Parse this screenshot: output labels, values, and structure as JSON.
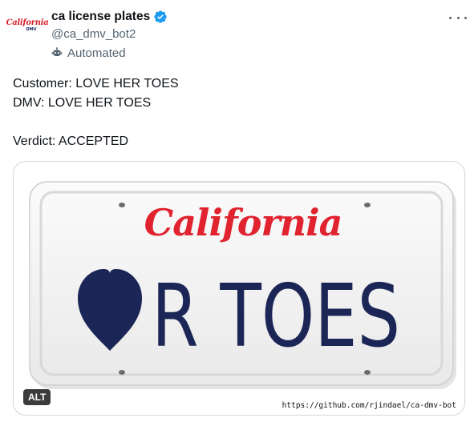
{
  "account": {
    "display_name": "ca license plates",
    "handle": "@ca_dmv_bot2",
    "automated_label": "Automated",
    "verified": true,
    "avatar_logo_text": "California",
    "avatar_logo_sub": "DMV"
  },
  "post": {
    "lines": [
      "Customer: LOVE HER TOES",
      "DMV: LOVE HER TOES",
      "",
      "Verdict: ACCEPTED"
    ]
  },
  "media": {
    "alt_label": "ALT",
    "plate_state": "California",
    "plate_text": "R TOES",
    "plate_symbol": "heart",
    "source_url": "https://github.com/rjindael/ca-dmv-bot"
  },
  "icons": [
    "verified-badge-icon",
    "robot-icon",
    "more-icon",
    "heart-icon"
  ],
  "colors": {
    "verified_blue": "#1d9bf0",
    "plate_red": "#e0232f",
    "plate_navy": "#1b2656",
    "secondary_text": "#536471"
  }
}
